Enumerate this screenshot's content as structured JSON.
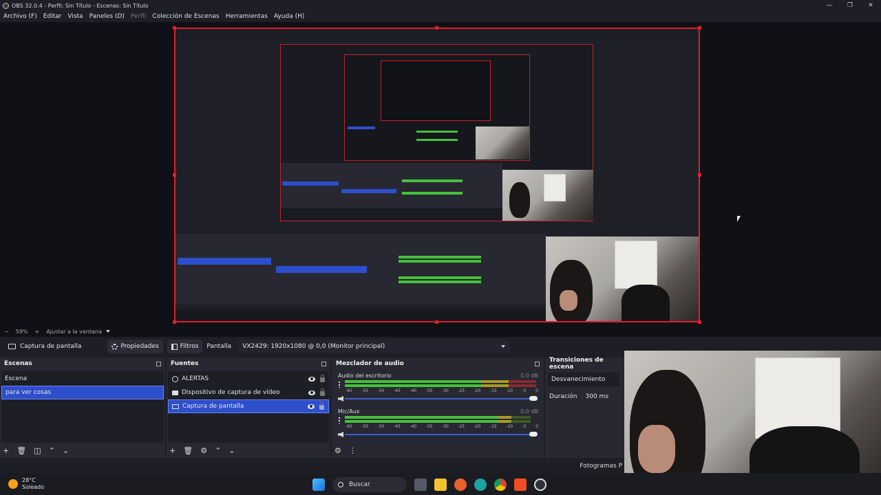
{
  "window": {
    "title": "OBS 32.0.4 - Perfil: Sin Título - Escenas: Sin Título",
    "minimize": "—",
    "maximize": "❐",
    "close": "✕"
  },
  "menu": [
    {
      "label": "Archivo (F)",
      "dim": false
    },
    {
      "label": "Editar",
      "dim": false
    },
    {
      "label": "Vista",
      "dim": false
    },
    {
      "label": "Paneles (D)",
      "dim": false
    },
    {
      "label": "Perfil",
      "dim": true
    },
    {
      "label": "Colección de Escenas",
      "dim": false
    },
    {
      "label": "Herramientas",
      "dim": false
    },
    {
      "label": "Ayuda (H)",
      "dim": false
    }
  ],
  "zoom": {
    "minus": "−",
    "percent": "59%",
    "plus": "+",
    "fit": "Ajustar a la ventana"
  },
  "source_toolbar": {
    "source_name": "Captura de pantalla",
    "properties": "Propiedades",
    "filters": "Filtros",
    "display_label": "Pantalla",
    "display_value": "VX2429: 1920x1080 @ 0,0 (Monitor principal)"
  },
  "scenes": {
    "title": "Escenas",
    "items": [
      {
        "label": "Escena",
        "selected": false
      },
      {
        "label": "para ver cosas",
        "selected": true
      }
    ]
  },
  "sources": {
    "title": "Fuentes",
    "items": [
      {
        "label": "ALERTAS",
        "icon": "globe-icon",
        "selected": false
      },
      {
        "label": "Dispositivo de captura de vídeo",
        "icon": "camera-icon",
        "selected": false
      },
      {
        "label": "Captura de pantalla",
        "icon": "monitor-icon",
        "selected": true
      }
    ]
  },
  "mixer": {
    "title": "Mezclador de audio",
    "ticks": [
      "-60",
      "-55",
      "-50",
      "-45",
      "-40",
      "-35",
      "-30",
      "-25",
      "-20",
      "-15",
      "-10",
      "-5",
      "0"
    ],
    "tracks": [
      {
        "name": "Audio del escritorio",
        "db": "0.0 dB",
        "level": 0.62
      },
      {
        "name": "Mic/Aux",
        "db": "0.0 dB",
        "level": 0.7
      }
    ]
  },
  "transitions": {
    "title": "Transiciones de escena",
    "selected": "Desvanecimiento",
    "duration_label": "Duración",
    "duration_value": "300 ms"
  },
  "status": {
    "fps": "Fotogramas P"
  },
  "taskbar": {
    "temp": "28°C",
    "weather": "Soleado",
    "search": "Buscar"
  },
  "colors": {
    "accent": "#2e4fcc",
    "preview_border": "#e0202a",
    "meter_green": "#47c13d",
    "meter_yellow": "#a99a26"
  }
}
